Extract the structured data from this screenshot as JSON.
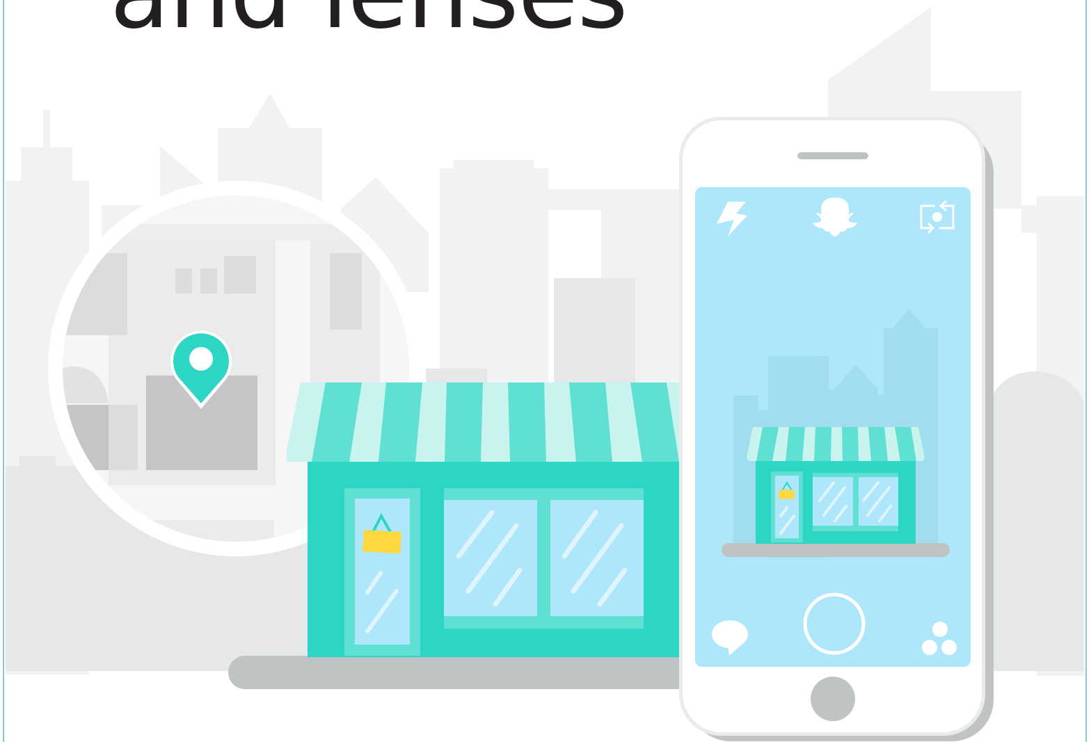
{
  "headline": {
    "text": "and lenses"
  },
  "colors": {
    "background": "#ffffff",
    "skyline_far": "#f1f2f2",
    "skyline_near": "#e6e7e8",
    "store_teal": "#2dd5c4",
    "awning_light": "#c8f3ef",
    "awning_mid": "#5fe0d3",
    "glass": "#aee7fb",
    "phone_screen": "#aee7fb",
    "phone_body": "#ffffff",
    "shadow_gray": "#bfc3c4",
    "bag_yellow": "#fdd83f",
    "pin_teal": "#2dd5c4",
    "headline_text": "#231f20"
  },
  "icons": {
    "map_pin": "map-pin-icon",
    "flash": "flash-icon",
    "ghost": "ghost-logo-icon",
    "camera_flip": "camera-flip-icon",
    "chat": "chat-bubble-icon",
    "stories": "stories-dots-icon",
    "capture": "capture-button",
    "home": "home-button"
  }
}
